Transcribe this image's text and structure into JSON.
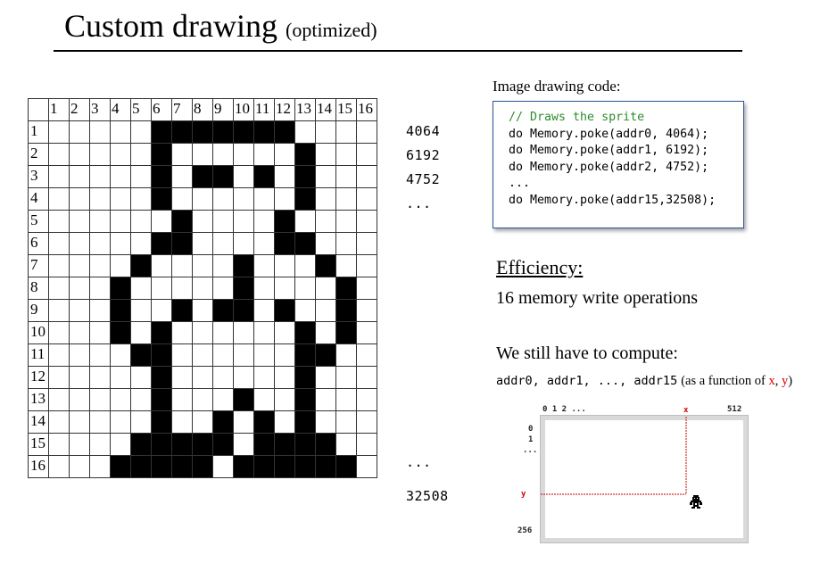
{
  "title": {
    "main": "Custom drawing",
    "sub": "(optimized)"
  },
  "grid": {
    "col_headers": [
      "1",
      "2",
      "3",
      "4",
      "5",
      "6",
      "7",
      "8",
      "9",
      "10",
      "11",
      "12",
      "13",
      "14",
      "15",
      "16"
    ],
    "row_headers": [
      "1",
      "2",
      "3",
      "4",
      "5",
      "6",
      "7",
      "8",
      "9",
      "10",
      "11",
      "12",
      "13",
      "14",
      "15",
      "16"
    ],
    "rows": [
      "0000011111110000",
      "0000010000001000",
      "0000010110101000",
      "0000010000001000",
      "0000001000010000",
      "0000011000011000",
      "0000100001000100",
      "0001000001000010",
      "0001001011010010",
      "0001010000001010",
      "0000110000001100",
      "0000010000001000",
      "0000010001001000",
      "0000010010101000",
      "0000111110111100",
      "0001111101111110"
    ]
  },
  "row_values": {
    "r1": "4064",
    "r2": "6192",
    "r3": "4752",
    "r4": "...",
    "r15": "...",
    "r16": "32508"
  },
  "code": {
    "label": "Image drawing code:",
    "comment": "// Draws the sprite",
    "lines": [
      "do Memory.poke(addr0, 4064);",
      "do Memory.poke(addr1, 6192);",
      "do Memory.poke(addr2, 4752);",
      "...",
      "do Memory.poke(addr15,32508);"
    ]
  },
  "efficiency": {
    "title": "Efficiency:",
    "text": "16 memory write operations"
  },
  "compute": {
    "title": "We still have to compute:",
    "addrs": "addr0, addr1, ..., addr15",
    "note_before": "(as a function of",
    "x": "x",
    "comma": ",",
    "y": "y",
    "note_after": ")"
  },
  "screen": {
    "top_labels": "0 1 2 ...",
    "x_label": "x",
    "right_label": "512",
    "left_labels": [
      "0",
      "1",
      "..."
    ],
    "y_label": "y",
    "bottom_label": "256",
    "colors": {
      "marker": "#d00000",
      "frame": "#d9d9d9"
    }
  }
}
